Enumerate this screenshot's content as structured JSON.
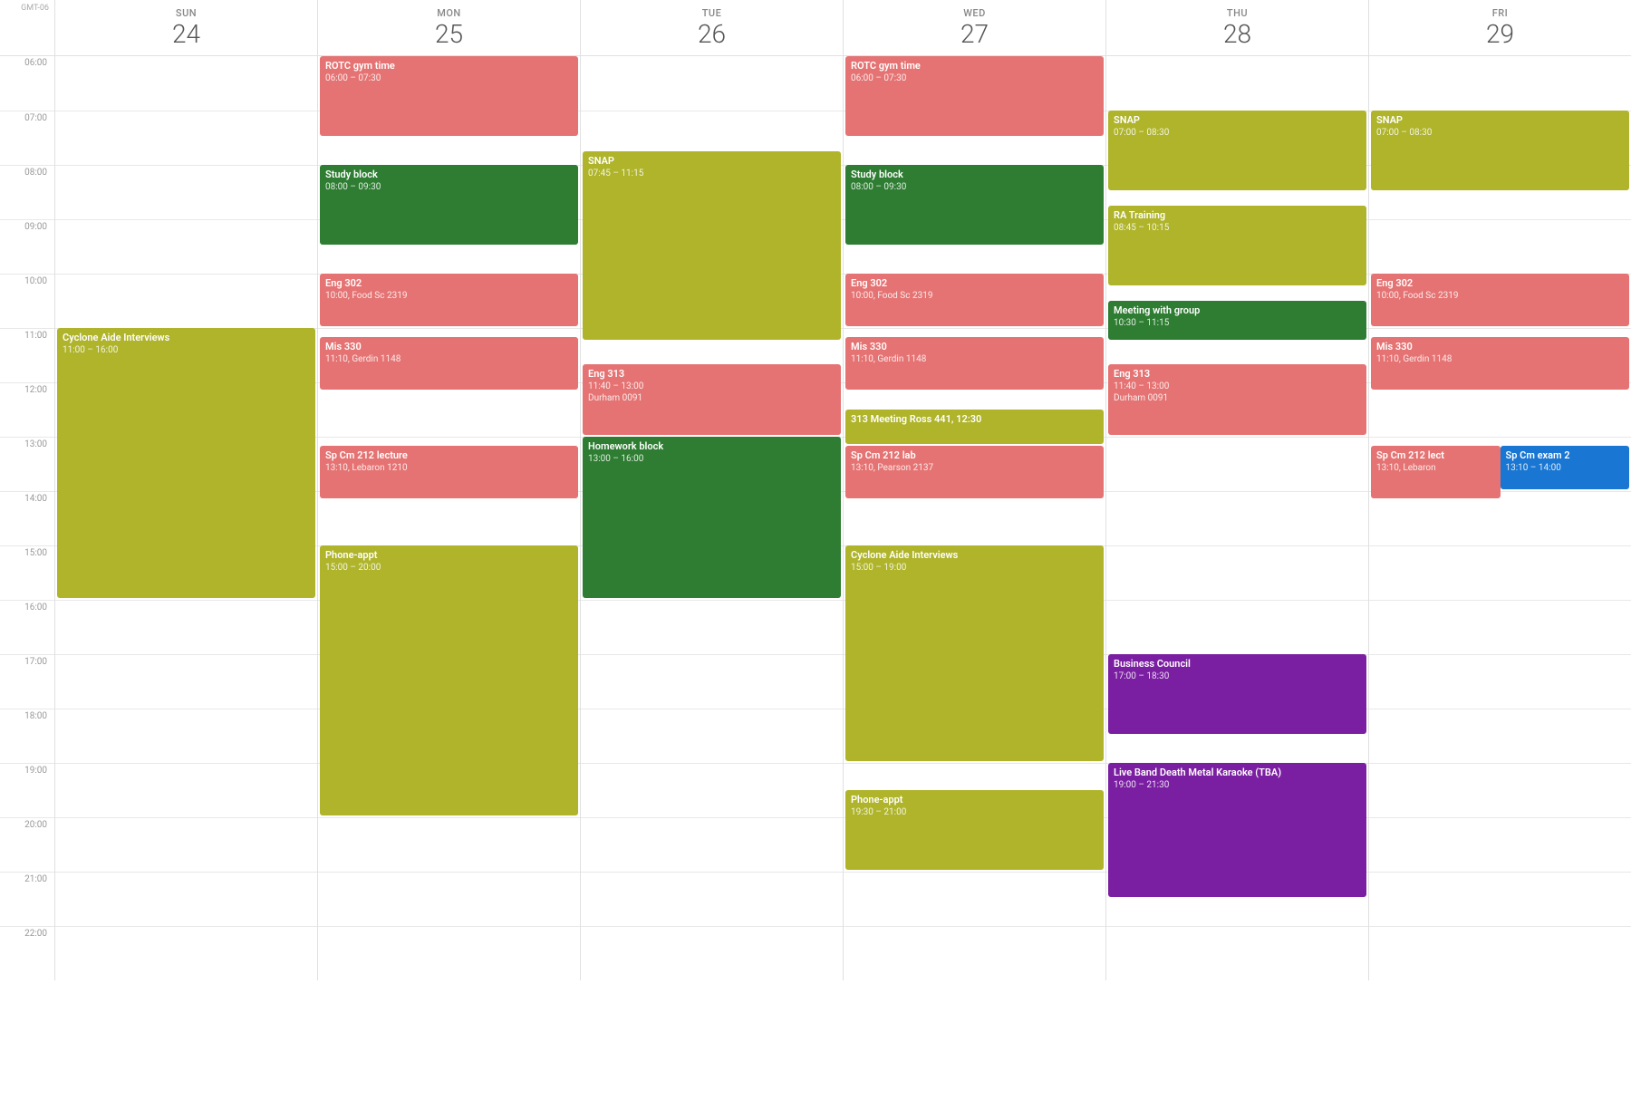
{
  "calendar": {
    "timezone": "GMT-06",
    "days": [
      {
        "name": "SUN",
        "number": "24"
      },
      {
        "name": "MON",
        "number": "25"
      },
      {
        "name": "TUE",
        "number": "26"
      },
      {
        "name": "WED",
        "number": "27"
      },
      {
        "name": "THU",
        "number": "28"
      },
      {
        "name": "FRI",
        "number": "29"
      }
    ],
    "hours": [
      "06:00",
      "07:00",
      "08:00",
      "09:00",
      "10:00",
      "11:00",
      "12:00",
      "13:00",
      "14:00",
      "15:00",
      "16:00",
      "17:00",
      "18:00",
      "19:00",
      "20:00",
      "21:00",
      "22:00"
    ],
    "events": [
      {
        "id": "mon-rotc",
        "day": 1,
        "title": "ROTC gym time",
        "time": "06:00 – 07:30",
        "startHour": 6,
        "startMin": 0,
        "endHour": 7,
        "endMin": 30,
        "color": "red"
      },
      {
        "id": "mon-study",
        "day": 1,
        "title": "Study block",
        "time": "08:00 – 09:30",
        "startHour": 8,
        "startMin": 0,
        "endHour": 9,
        "endMin": 30,
        "color": "green"
      },
      {
        "id": "mon-eng302",
        "day": 1,
        "title": "Eng 302",
        "time": "10:00, Food Sc 2319",
        "startHour": 10,
        "startMin": 0,
        "endHour": 11,
        "endMin": 0,
        "color": "red"
      },
      {
        "id": "mon-mis330",
        "day": 1,
        "title": "Mis 330",
        "time": "11:10, Gerdin 1148",
        "startHour": 11,
        "startMin": 10,
        "endHour": 12,
        "endMin": 10,
        "color": "red"
      },
      {
        "id": "mon-spcm",
        "day": 1,
        "title": "Sp Cm 212 lecture",
        "time": "13:10, Lebaron 1210",
        "startHour": 13,
        "startMin": 10,
        "endHour": 14,
        "endMin": 10,
        "color": "red"
      },
      {
        "id": "mon-phone",
        "day": 1,
        "title": "Phone-appt",
        "time": "15:00 – 20:00",
        "startHour": 15,
        "startMin": 0,
        "endHour": 20,
        "endMin": 0,
        "color": "lime"
      },
      {
        "id": "tue-snap",
        "day": 2,
        "title": "SNAP",
        "time": "07:45 – 11:15",
        "startHour": 7,
        "startMin": 45,
        "endHour": 11,
        "endMin": 15,
        "color": "lime"
      },
      {
        "id": "tue-eng313",
        "day": 2,
        "title": "Eng 313",
        "time": "11:40 – 13:00\nDurham 0091",
        "startHour": 11,
        "startMin": 40,
        "endHour": 13,
        "endMin": 0,
        "color": "red"
      },
      {
        "id": "tue-hw",
        "day": 2,
        "title": "Homework block",
        "time": "13:00 – 16:00",
        "startHour": 13,
        "startMin": 0,
        "endHour": 16,
        "endMin": 0,
        "color": "green"
      },
      {
        "id": "wed-rotc",
        "day": 3,
        "title": "ROTC gym time",
        "time": "06:00 – 07:30",
        "startHour": 6,
        "startMin": 0,
        "endHour": 7,
        "endMin": 30,
        "color": "red"
      },
      {
        "id": "wed-study",
        "day": 3,
        "title": "Study block",
        "time": "08:00 – 09:30",
        "startHour": 8,
        "startMin": 0,
        "endHour": 9,
        "endMin": 30,
        "color": "green"
      },
      {
        "id": "wed-eng302",
        "day": 3,
        "title": "Eng 302",
        "time": "10:00, Food Sc 2319",
        "startHour": 10,
        "startMin": 0,
        "endHour": 11,
        "endMin": 0,
        "color": "red"
      },
      {
        "id": "wed-mis330",
        "day": 3,
        "title": "Mis 330",
        "time": "11:10, Gerdin 1148",
        "startHour": 11,
        "startMin": 10,
        "endHour": 12,
        "endMin": 10,
        "color": "red"
      },
      {
        "id": "wed-313meeting",
        "day": 3,
        "title": "313 Meeting Ross 441, 12:30",
        "time": "",
        "startHour": 12,
        "startMin": 30,
        "endHour": 13,
        "endMin": 10,
        "color": "lime"
      },
      {
        "id": "wed-spcmlab",
        "day": 3,
        "title": "Sp Cm 212 lab",
        "time": "13:10, Pearson 2137",
        "startHour": 13,
        "startMin": 10,
        "endHour": 14,
        "endMin": 10,
        "color": "red"
      },
      {
        "id": "wed-cyclone",
        "day": 3,
        "title": "Cyclone Aide Interviews",
        "time": "15:00 – 19:00",
        "startHour": 15,
        "startMin": 0,
        "endHour": 19,
        "endMin": 0,
        "color": "lime"
      },
      {
        "id": "wed-phone",
        "day": 3,
        "title": "Phone-appt",
        "time": "19:30 – 21:00",
        "startHour": 19,
        "startMin": 30,
        "endHour": 21,
        "endMin": 0,
        "color": "lime"
      },
      {
        "id": "thu-snap",
        "day": 4,
        "title": "SNAP",
        "time": "07:00 – 08:30",
        "startHour": 7,
        "startMin": 0,
        "endHour": 8,
        "endMin": 30,
        "color": "lime"
      },
      {
        "id": "thu-ra",
        "day": 4,
        "title": "RA Training",
        "time": "08:45 – 10:15",
        "startHour": 8,
        "startMin": 45,
        "endHour": 10,
        "endMin": 15,
        "color": "lime"
      },
      {
        "id": "thu-meeting",
        "day": 4,
        "title": "Meeting with group",
        "time": "10:30 – 11:15",
        "startHour": 10,
        "startMin": 30,
        "endHour": 11,
        "endMin": 15,
        "color": "green"
      },
      {
        "id": "thu-eng313",
        "day": 4,
        "title": "Eng 313",
        "time": "11:40 – 13:00\nDurham 0091",
        "startHour": 11,
        "startMin": 40,
        "endHour": 13,
        "endMin": 0,
        "color": "red"
      },
      {
        "id": "thu-business",
        "day": 4,
        "title": "Business Council",
        "time": "17:00 – 18:30",
        "startHour": 17,
        "startMin": 0,
        "endHour": 18,
        "endMin": 30,
        "color": "purple"
      },
      {
        "id": "thu-liveband",
        "day": 4,
        "title": "Live Band Death Metal Karaoke (TBA)",
        "time": "19:00 – 21:30",
        "startHour": 19,
        "startMin": 0,
        "endHour": 21,
        "endMin": 30,
        "color": "purple"
      },
      {
        "id": "fri-snap",
        "day": 5,
        "title": "SNAP",
        "time": "07:00 – 08:30",
        "startHour": 7,
        "startMin": 0,
        "endHour": 8,
        "endMin": 30,
        "color": "lime"
      },
      {
        "id": "fri-eng302",
        "day": 5,
        "title": "Eng 302",
        "time": "10:00, Food Sc 2319",
        "startHour": 10,
        "startMin": 0,
        "endHour": 11,
        "endMin": 0,
        "color": "red"
      },
      {
        "id": "fri-mis330",
        "day": 5,
        "title": "Mis 330",
        "time": "11:10, Gerdin 1148",
        "startHour": 11,
        "startMin": 10,
        "endHour": 12,
        "endMin": 10,
        "color": "red"
      },
      {
        "id": "fri-spcmlect",
        "day": 5,
        "title": "Sp Cm 212 lect",
        "time": "13:10, Lebaron",
        "startHour": 13,
        "startMin": 10,
        "endHour": 14,
        "endMin": 10,
        "color": "red",
        "rightSplit": true
      },
      {
        "id": "fri-spcmexam",
        "day": 5,
        "title": "Sp Cm exam 2",
        "time": "13:10 – 14:00",
        "startHour": 13,
        "startMin": 10,
        "endHour": 14,
        "endMin": 0,
        "color": "blue",
        "leftSplit": true
      },
      {
        "id": "sun-cyclone",
        "day": 0,
        "title": "Cyclone Aide Interviews",
        "time": "11:00 – 16:00",
        "startHour": 11,
        "startMin": 0,
        "endHour": 16,
        "endMin": 0,
        "color": "lime"
      }
    ]
  }
}
